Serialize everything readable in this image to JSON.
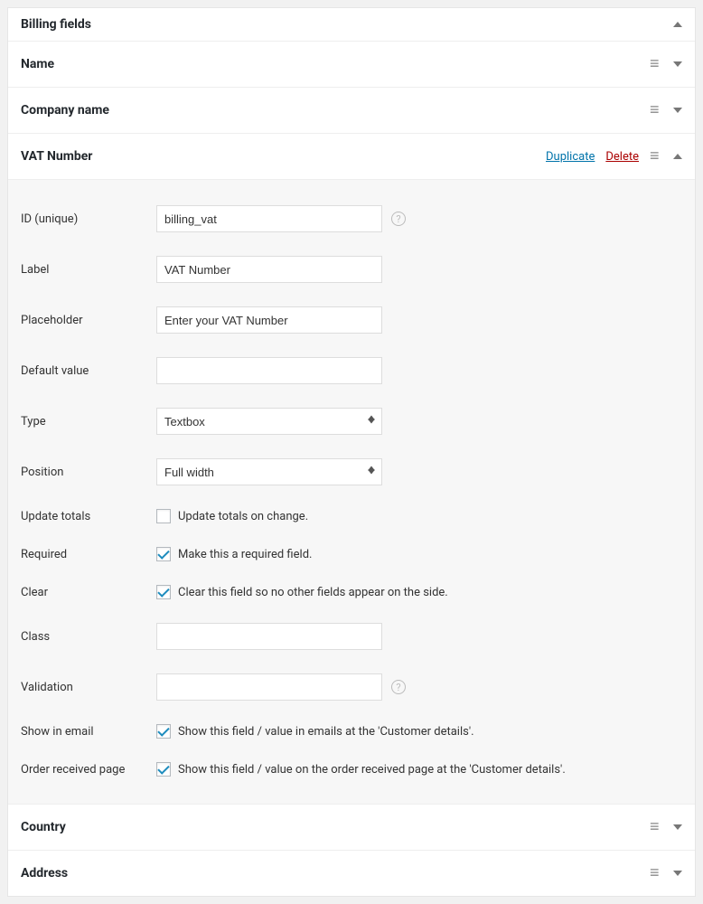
{
  "panel": {
    "title": "Billing fields"
  },
  "rows": {
    "name": {
      "title": "Name"
    },
    "company": {
      "title": "Company name"
    },
    "vat": {
      "title": "VAT Number",
      "actions": {
        "duplicate": "Duplicate",
        "delete": "Delete"
      },
      "fields": {
        "id_label": "ID (unique)",
        "id_value": "billing_vat",
        "label_label": "Label",
        "label_value": "VAT Number",
        "placeholder_label": "Placeholder",
        "placeholder_value": "Enter your VAT Number",
        "default_label": "Default value",
        "default_value": "",
        "type_label": "Type",
        "type_value": "Textbox",
        "position_label": "Position",
        "position_value": "Full width",
        "update_totals_label": "Update totals",
        "update_totals_text": "Update totals on change.",
        "update_totals_checked": false,
        "required_label": "Required",
        "required_text": "Make this a required field.",
        "required_checked": true,
        "clear_label": "Clear",
        "clear_text": "Clear this field so no other fields appear on the side.",
        "clear_checked": true,
        "class_label": "Class",
        "class_value": "",
        "validation_label": "Validation",
        "validation_value": "",
        "show_email_label": "Show in email",
        "show_email_text": "Show this field / value in emails at the 'Customer details'.",
        "show_email_checked": true,
        "order_received_label": "Order received page",
        "order_received_text": "Show this field / value on the order received page at the 'Customer details'.",
        "order_received_checked": true
      }
    },
    "country": {
      "title": "Country"
    },
    "address": {
      "title": "Address"
    }
  }
}
